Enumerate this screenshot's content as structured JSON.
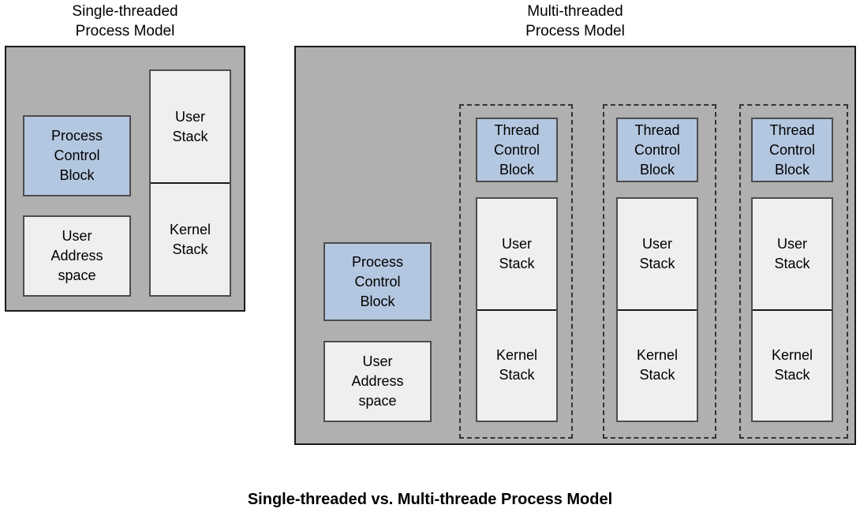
{
  "caption": "Single-threaded vs. Multi-threade Process Model",
  "single_threaded": {
    "title": "Single-threaded\nProcess Model",
    "process_control_block": "Process\nControl\nBlock",
    "user_address_space": "User\nAddress\nspace",
    "user_stack": "User\nStack",
    "kernel_stack": "Kernel\nStack"
  },
  "multi_threaded": {
    "title": "Multi-threaded\nProcess Model",
    "process_control_block": "Process\nControl\nBlock",
    "user_address_space": "User\nAddress\nspace",
    "threads": [
      {
        "thread_control_block": "Thread\nControl\nBlock",
        "user_stack": "User\nStack",
        "kernel_stack": "Kernel\nStack"
      },
      {
        "thread_control_block": "Thread\nControl\nBlock",
        "user_stack": "User\nStack",
        "kernel_stack": "Kernel\nStack"
      },
      {
        "thread_control_block": "Thread\nControl\nBlock",
        "user_stack": "User\nStack",
        "kernel_stack": "Kernel\nStack"
      }
    ]
  },
  "colors": {
    "panel_background": "#b0b0b0",
    "control_block_fill": "#b4c7e0",
    "stack_fill": "#efefef",
    "border": "#4d4d4d",
    "outer_border": "#1a1a1a",
    "text": "#000000",
    "page_background": "#ffffff"
  }
}
